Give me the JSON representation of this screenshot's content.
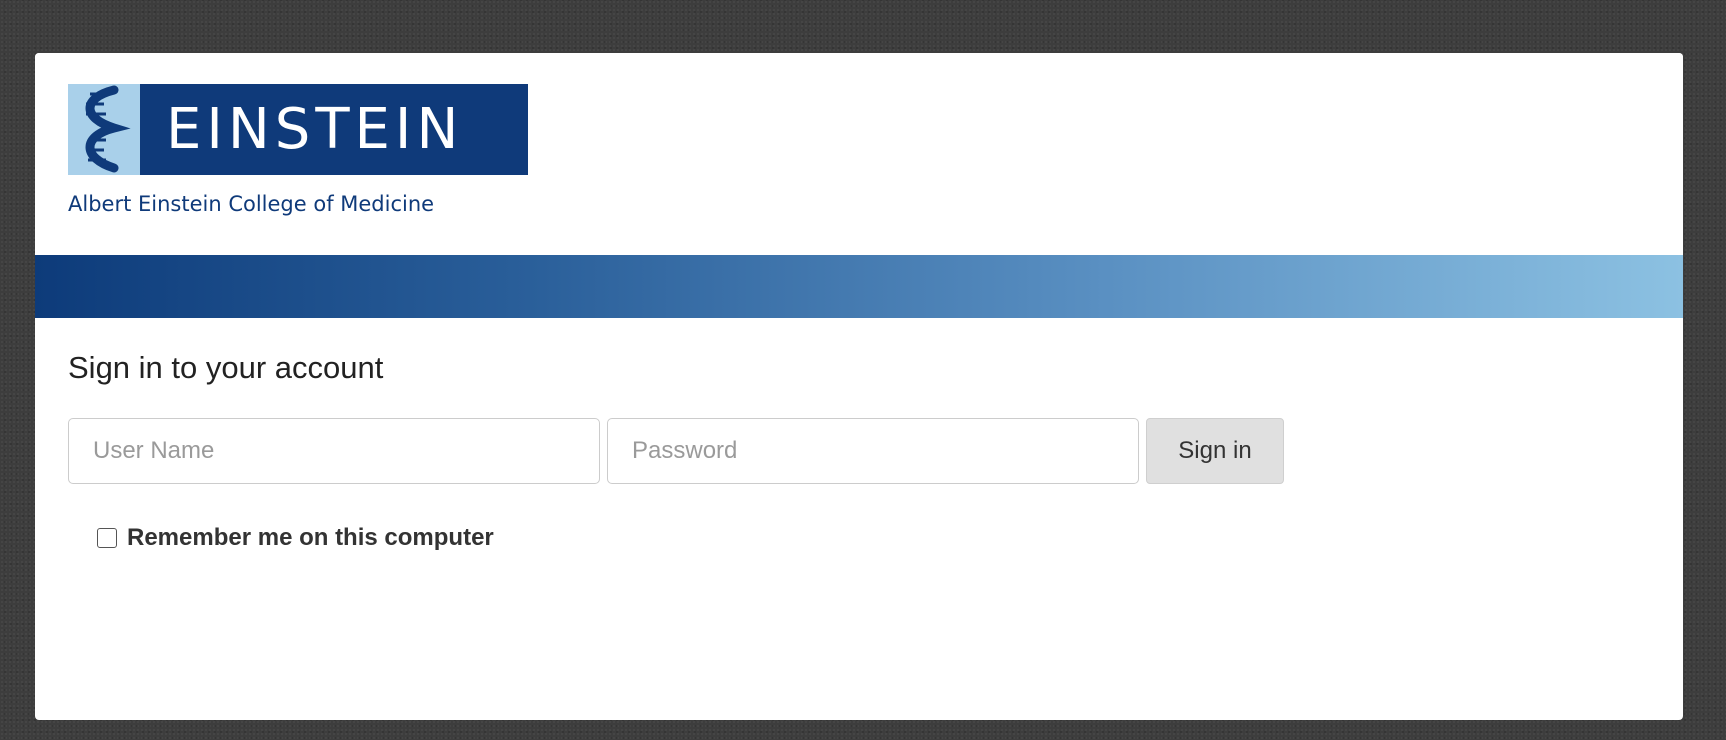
{
  "logo": {
    "wordmark": "EINSTEIN",
    "subtitle": "Albert Einstein College of Medicine",
    "brand_color": "#0f3a7a",
    "accent_light": "#8cc1e2"
  },
  "form": {
    "heading": "Sign in to your account",
    "username_placeholder": "User Name",
    "password_placeholder": "Password",
    "submit_label": "Sign in",
    "remember_label": "Remember me on this computer",
    "remember_checked": false
  }
}
